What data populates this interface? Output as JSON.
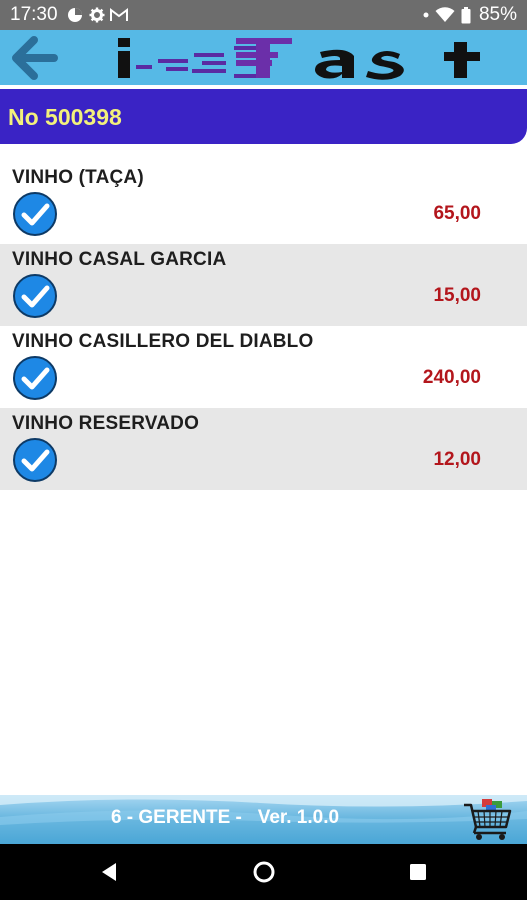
{
  "status_bar": {
    "time": "17:30",
    "icons": [
      "data-saver-icon",
      "gear-icon",
      "gmail-icon"
    ],
    "right_icons": [
      "dot-icon",
      "wifi-icon",
      "battery-icon"
    ],
    "battery": "85%"
  },
  "header": {
    "back_icon": "arrow-left-icon",
    "logo_text": "i-Fast"
  },
  "order": {
    "label": "No 500398"
  },
  "colors": {
    "header_bg": "#56b9e6",
    "order_bg": "#3a23c5",
    "order_text": "#f3f17c",
    "price": "#b3161c",
    "check_blue": "#1e88e5"
  },
  "items": [
    {
      "name": "VINHO (TAÇA)",
      "price": "65,00",
      "checked": true
    },
    {
      "name": "VINHO CASAL GARCIA",
      "price": "15,00",
      "checked": true
    },
    {
      "name": "VINHO CASILLERO DEL DIABLO",
      "price": "240,00",
      "checked": true
    },
    {
      "name": "VINHO RESERVADO",
      "price": "12,00",
      "checked": true
    }
  ],
  "footer": {
    "text": "6 - GERENTE -   Ver. 1.0.0",
    "cart_icon": "shopping-cart-icon"
  },
  "nav": {
    "back": "nav-back-icon",
    "home": "nav-home-icon",
    "recents": "nav-recents-icon"
  }
}
